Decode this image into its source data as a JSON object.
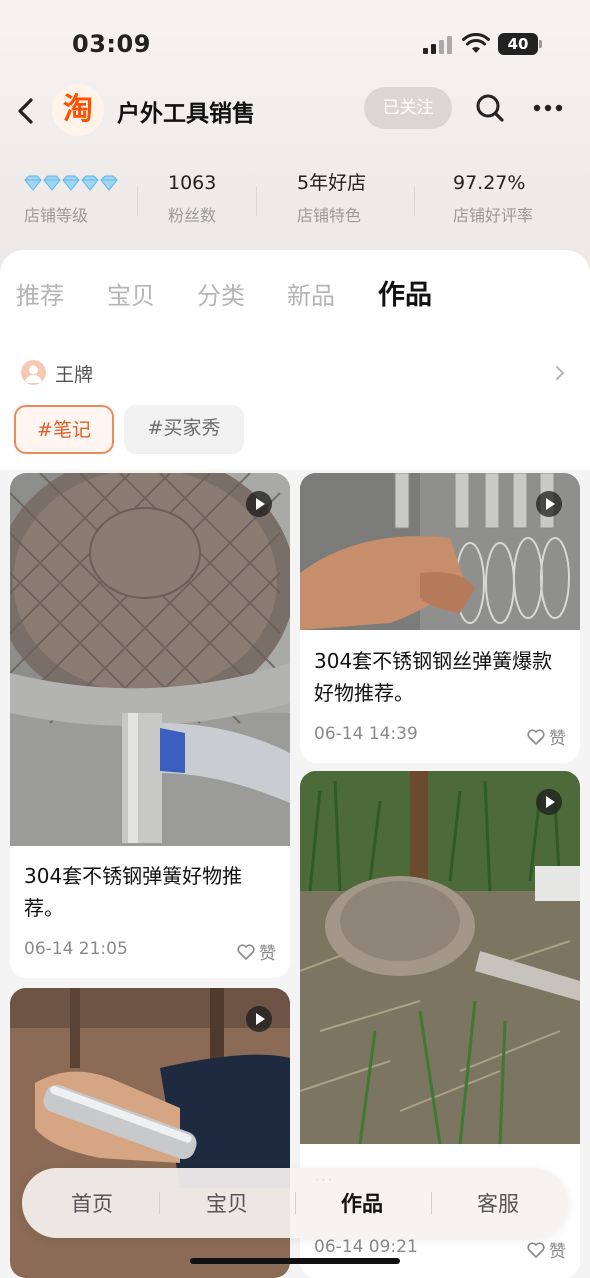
{
  "status_bar": {
    "time": "03:09",
    "battery": "40"
  },
  "header": {
    "logo_char": "淘",
    "shop_name": "户外工具销售",
    "follow_label": "已关注"
  },
  "stats": [
    {
      "value": "",
      "label": "店铺等级",
      "diamonds": 5
    },
    {
      "value": "1063",
      "label": "粉丝数"
    },
    {
      "value": "5年好店",
      "label": "店铺特色"
    },
    {
      "value": "97.27%",
      "label": "店铺好评率"
    }
  ],
  "tabs": [
    "推荐",
    "宝贝",
    "分类",
    "新品",
    "作品"
  ],
  "active_tab": "作品",
  "author": {
    "name": "王牌"
  },
  "chips": {
    "active": "#笔记",
    "normal": "#买家秀"
  },
  "cards": {
    "left1": {
      "title": "304套不锈钢弹簧好物推荐。",
      "date": "06-14 21:05",
      "like": "赞"
    },
    "right1": {
      "title": "304套不锈钢钢丝弹簧爆款好物推荐。",
      "date": "06-14 14:39",
      "like": "赞"
    },
    "right2": {
      "title": "...",
      "date": "06-14 09:21",
      "like": "赞"
    }
  },
  "bottom_nav": [
    "首页",
    "宝贝",
    "作品",
    "客服"
  ],
  "bottom_nav_active": "作品",
  "colors": {
    "accent": "#ff5000",
    "chip_active": "#e05e26"
  }
}
